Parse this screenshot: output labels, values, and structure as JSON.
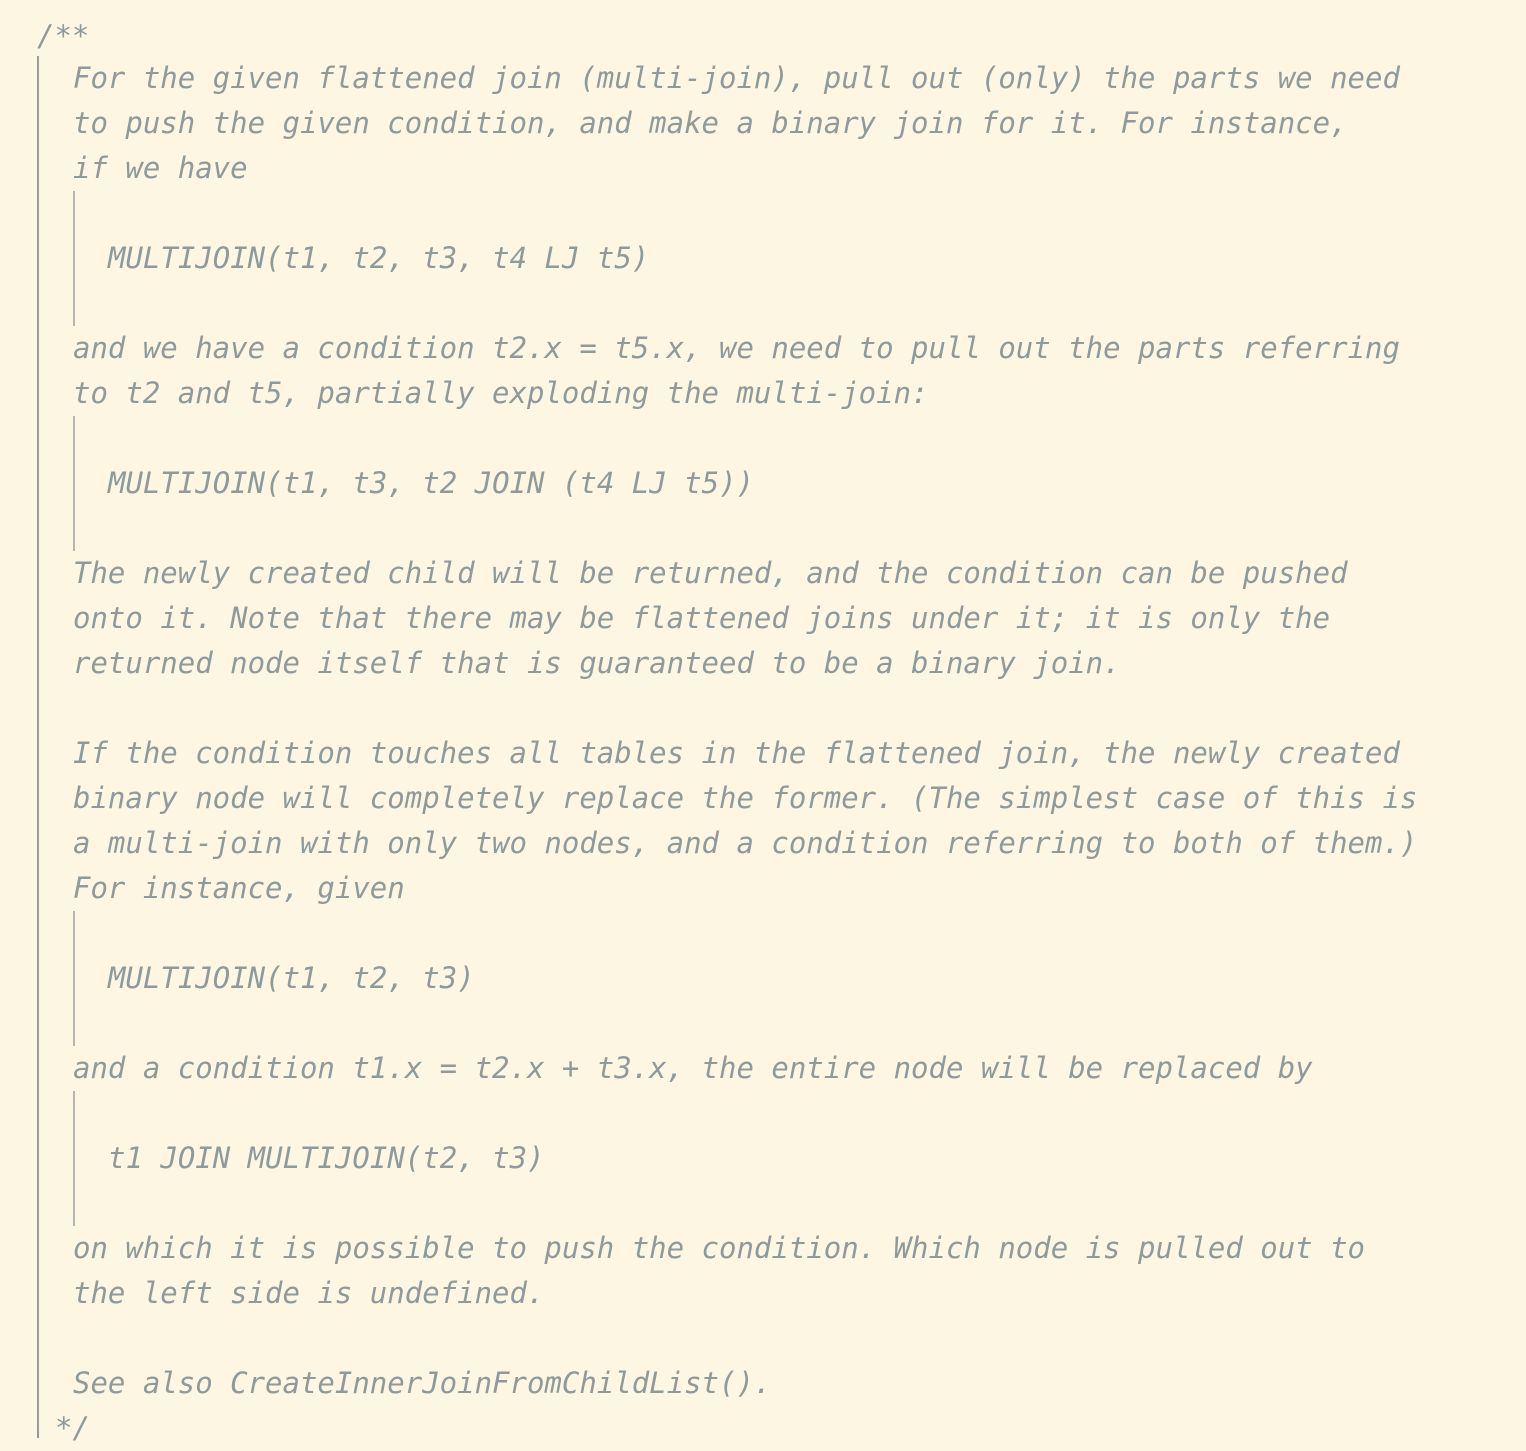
{
  "comment": {
    "open": "/**",
    "close": "*/",
    "blocks": [
      {
        "type": "para",
        "lines": [
          "For the given flattened join (multi-join), pull out (only) the parts we need",
          "to push the given condition, and make a binary join for it. For instance,",
          "if we have"
        ]
      },
      {
        "type": "quote",
        "text": "MULTIJOIN(t1, t2, t3, t4 LJ t5)"
      },
      {
        "type": "para",
        "lines": [
          "and we have a condition t2.x = t5.x, we need to pull out the parts referring",
          "to t2 and t5, partially exploding the multi-join:"
        ]
      },
      {
        "type": "quote",
        "text": "MULTIJOIN(t1, t3, t2 JOIN (t4 LJ t5))"
      },
      {
        "type": "para",
        "lines": [
          "The newly created child will be returned, and the condition can be pushed",
          "onto it. Note that there may be flattened joins under it; it is only the",
          "returned node itself that is guaranteed to be a binary join."
        ]
      },
      {
        "type": "gap"
      },
      {
        "type": "para",
        "lines": [
          "If the condition touches all tables in the flattened join, the newly created",
          "binary node will completely replace the former. (The simplest case of this is",
          "a multi-join with only two nodes, and a condition referring to both of them.)",
          "For instance, given"
        ]
      },
      {
        "type": "quote",
        "text": "MULTIJOIN(t1, t2, t3)"
      },
      {
        "type": "para",
        "lines": [
          "and a condition t1.x = t2.x + t3.x, the entire node will be replaced by"
        ]
      },
      {
        "type": "quote",
        "text": "t1 JOIN MULTIJOIN(t2, t3)"
      },
      {
        "type": "para",
        "lines": [
          "on which it is possible to push the condition. Which node is pulled out to",
          "the left side is undefined."
        ]
      },
      {
        "type": "gap"
      },
      {
        "type": "para",
        "lines": [
          "See also CreateInnerJoinFromChildList()."
        ]
      }
    ]
  }
}
